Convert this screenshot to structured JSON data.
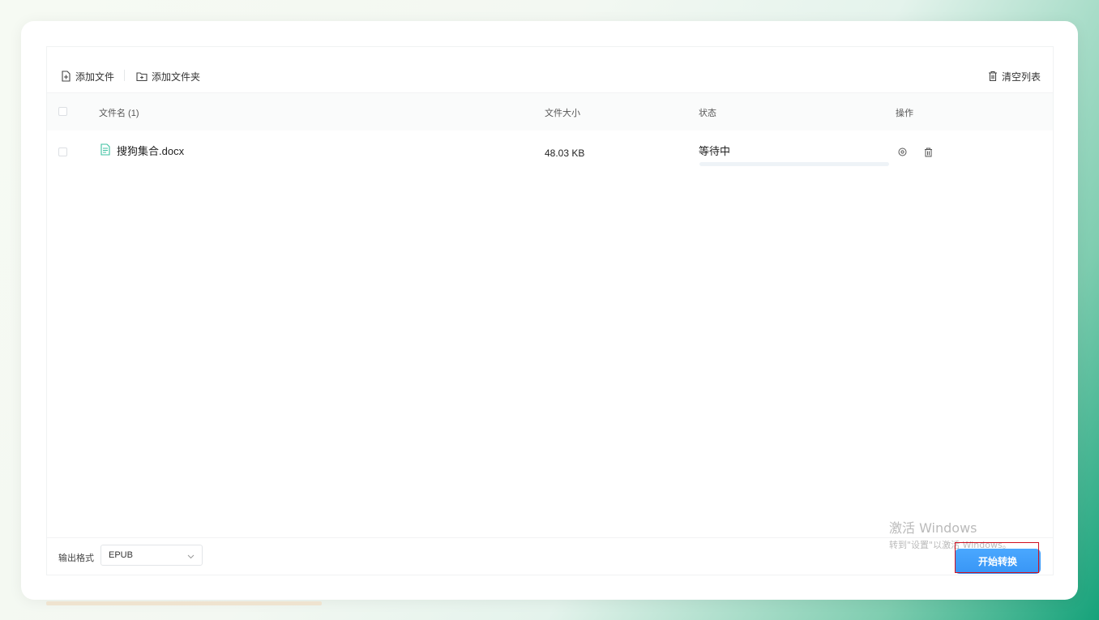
{
  "toolbar": {
    "add_file": "添加文件",
    "add_folder": "添加文件夹",
    "clear_list": "清空列表"
  },
  "table": {
    "headers": {
      "name": "文件名 (1)",
      "size": "文件大小",
      "status": "状态",
      "actions": "操作"
    },
    "rows": [
      {
        "name": "搜狗集合.docx",
        "size": "48.03 KB",
        "status": "等待中",
        "progress": 0
      }
    ]
  },
  "footer": {
    "format_label": "输出格式",
    "format_value": "EPUB",
    "start_button": "开始转换"
  },
  "watermark": {
    "title": "激活 Windows",
    "subtitle": "转到\"设置\"以激活 Windows。"
  },
  "colors": {
    "accent": "#409eff",
    "file_icon": "#3cc0a0",
    "highlight": "#d01020"
  },
  "icons": [
    "add-file-icon",
    "add-folder-icon",
    "trash-icon",
    "document-icon",
    "preview-icon",
    "delete-icon",
    "chevron-down-icon"
  ]
}
